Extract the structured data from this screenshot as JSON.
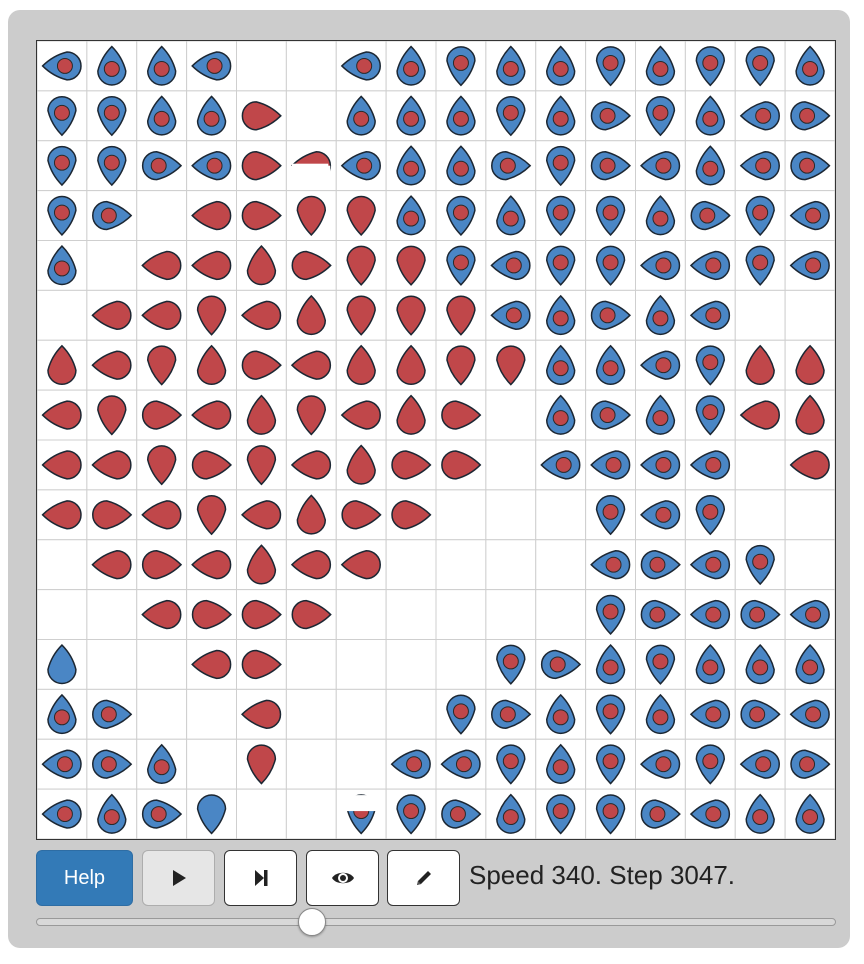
{
  "grid": {
    "rows": [
      "BBBB..BBBBBBBBBB",
      "BBBBR.BBBBBBBBBB",
      "BBBBRHBBBBBBBBBB",
      "BB.RRRRBBBBBBBBB",
      "B.RRRRRRBBBBBBBB",
      ".RRRRRRRRBBBBB..",
      "RRRRRRRRRRBBBBRR",
      "RRRRRRRRR.BBBBRR",
      "RRRRRRRRR.BBBB.R",
      "RRRRRRRR...BBB..",
      ".RRRRRR....BBBB.",
      "..RRRR.....BBBBB",
      "P..RR....BBBBBBB",
      "BB..R...BBBBBBBB",
      "BBB.R..BBBBBBBBB",
      "BBBP..UBBBBBBBBB"
    ],
    "orientations": [
      "LUULLLLUDUUDUDDU",
      "DDUURLUUUDURDULR",
      "DDRLRLLUURDRLULR",
      "DRLLRDDUDUDDURDL",
      "ULLLURDDDLDDLLDL",
      "LLLDLUDDDLURULLL",
      "ULDURLUUDDUULDUU",
      "LDRLUDLURLURUDLU",
      "LLDRDLURRLLLLLLL",
      "LRLDLURRLLLDLDLL",
      "LLRLULLLLLLLRLDL",
      "LLLRRRLLLLLDRLRL",
      "ULLLRLLLLDRUDUUU",
      "UR.LLLLLDRUDULRL",
      "LRU.DLLLLDUDLDLR",
      "LUR.LLDDRUDDRLUU"
    ],
    "legend": {
      "B": "blue agent with red core",
      "R": "red agent",
      "H": "half red / half white agent",
      "P": "plain blue agent",
      "U": "blue agent facing up (partial)",
      ".": "empty cell"
    }
  },
  "controls": {
    "help_label": "Help",
    "play_icon": "play-icon",
    "step_icon": "step-forward-icon",
    "view_icon": "eye-icon",
    "edit_icon": "pencil-icon"
  },
  "status": {
    "text": "Speed 340. Step 3047.",
    "speed": 340,
    "step": 3047
  },
  "slider": {
    "value": 0.345
  },
  "colors": {
    "blue": "#4a86c5",
    "red": "#c0474a",
    "help_button": "#337ab7",
    "frame": "#cccccc",
    "grid_line": "#cfcfcf"
  }
}
